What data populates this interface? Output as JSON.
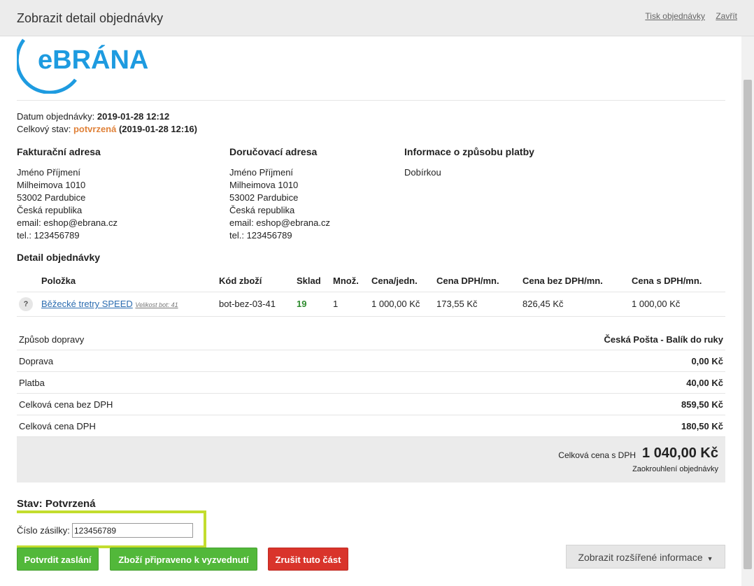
{
  "header": {
    "title": "Zobrazit detail objednávky",
    "print_link": "Tisk objednávky",
    "close_link": "Zavřít"
  },
  "logo": {
    "text": "eBRÁNA",
    "color": "#1e9be0"
  },
  "order": {
    "date_label": "Datum objednávky:",
    "date_value": "2019-01-28 12:12",
    "status_label": "Celkový stav:",
    "status_value": "potvrzená",
    "status_time": "(2019-01-28 12:16)"
  },
  "billing": {
    "heading": "Fakturační adresa",
    "lines": [
      "Jméno Příjmení",
      "Milheimova 1010",
      "53002 Pardubice",
      "Česká republika",
      "email: eshop@ebrana.cz",
      "tel.: 123456789"
    ]
  },
  "shipping": {
    "heading": "Doručovací adresa",
    "lines": [
      "Jméno Příjmení",
      "Milheimova 1010",
      "53002 Pardubice",
      "Česká republika",
      "email: eshop@ebrana.cz",
      "tel.: 123456789"
    ]
  },
  "payment": {
    "heading": "Informace o způsobu platby",
    "method": "Dobírkou"
  },
  "detail": {
    "heading": "Detail objednávky",
    "columns": [
      "Položka",
      "Kód zboží",
      "Sklad",
      "Množ.",
      "Cena/jedn.",
      "Cena DPH/mn.",
      "Cena bez DPH/mn.",
      "Cena s DPH/mn."
    ],
    "rows": [
      {
        "help": "?",
        "name": "Běžecké tretry SPEED",
        "variant": "Velikost bot: 41",
        "code": "bot-bez-03-41",
        "stock": "19",
        "qty": "1",
        "unit_price": "1 000,00 Kč",
        "vat": "173,55 Kč",
        "without_vat": "826,45 Kč",
        "with_vat": "1 000,00 Kč"
      }
    ]
  },
  "summary": [
    {
      "label": "Způsob dopravy",
      "value": "Česká Pošta - Balík do ruky"
    },
    {
      "label": "Doprava",
      "value": "0,00 Kč"
    },
    {
      "label": "Platba",
      "value": "40,00 Kč"
    },
    {
      "label": "Celková cena bez DPH",
      "value": "859,50 Kč"
    },
    {
      "label": "Celková cena DPH",
      "value": "180,50 Kč"
    }
  ],
  "total": {
    "label": "Celková cena s DPH",
    "value": "1 040,00 Kč",
    "rounding": "Zaokrouhlení objednávky"
  },
  "state": {
    "heading": "Stav: Potvrzená",
    "tracking_label": "Číslo zásilky:",
    "tracking_value": "123456789"
  },
  "actions": {
    "confirm": "Potvrdit zaslání",
    "ready": "Zboží připraveno k vyzvednutí",
    "cancel": "Zrušit tuto část",
    "more": "Zobrazit rozšířené informace"
  }
}
